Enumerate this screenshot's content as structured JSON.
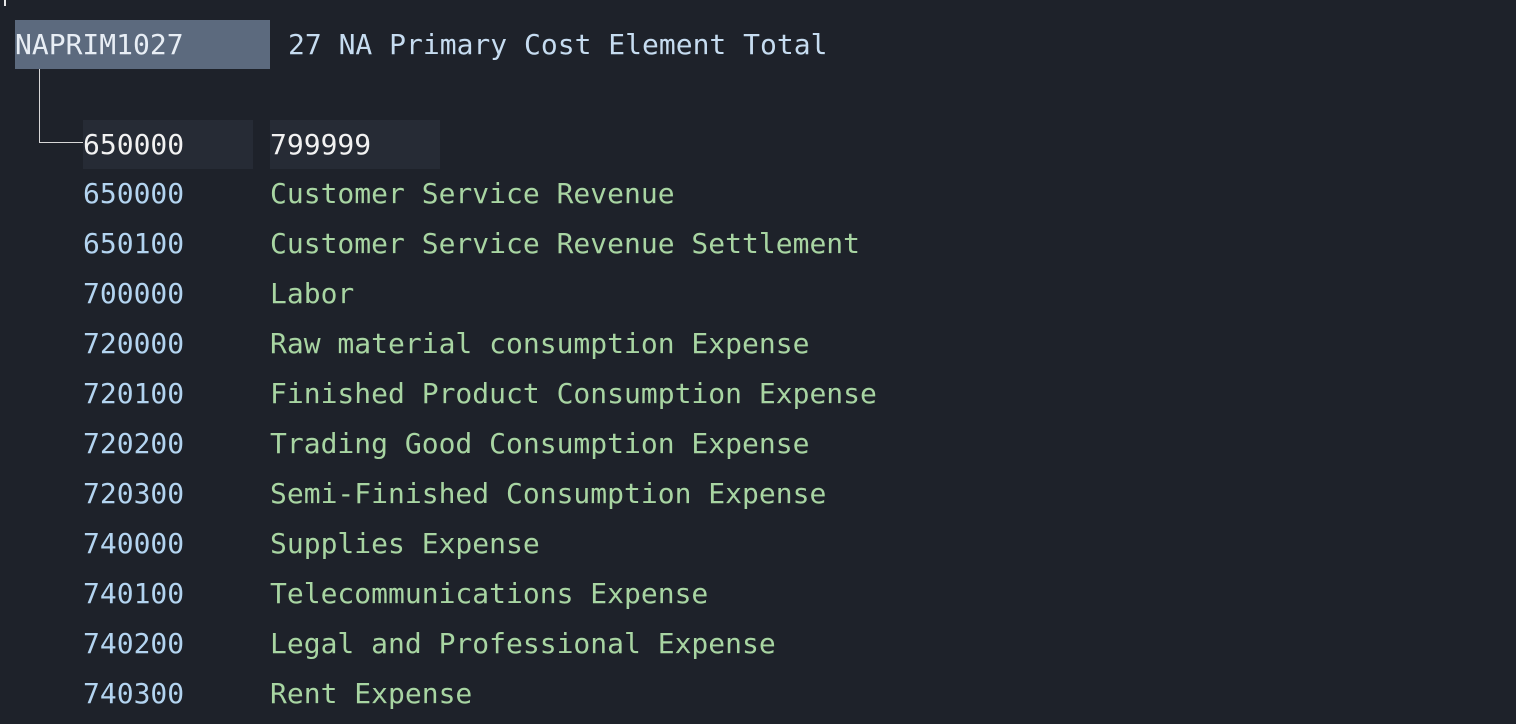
{
  "group": {
    "id": "NAPRIM1027",
    "title": "27 NA Primary Cost Element Total"
  },
  "range": {
    "from": "650000",
    "to": "799999"
  },
  "elements": [
    {
      "code": "650000",
      "description": "Customer Service Revenue"
    },
    {
      "code": "650100",
      "description": "Customer Service Revenue Settlement"
    },
    {
      "code": "700000",
      "description": "Labor"
    },
    {
      "code": "720000",
      "description": "Raw material consumption Expense"
    },
    {
      "code": "720100",
      "description": "Finished Product Consumption Expense"
    },
    {
      "code": "720200",
      "description": "Trading Good Consumption Expense"
    },
    {
      "code": "720300",
      "description": "Semi-Finished Consumption Expense"
    },
    {
      "code": "740000",
      "description": "Supplies Expense"
    },
    {
      "code": "740100",
      "description": "Telecommunications Expense"
    },
    {
      "code": "740200",
      "description": "Legal and Professional Expense"
    },
    {
      "code": "740300",
      "description": "Rent Expense"
    }
  ],
  "colors": {
    "background": "#1e222a",
    "selected_group": "#5c6a7e",
    "range_cell": "#262b35",
    "code_text": "#b3d4f0",
    "description_text": "#a8d5a2"
  }
}
